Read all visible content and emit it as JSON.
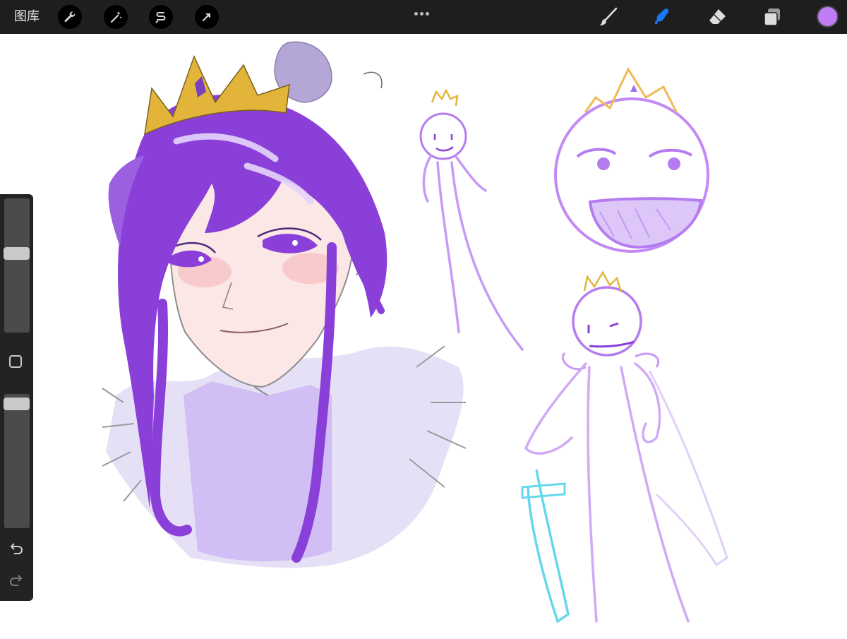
{
  "app": {
    "gallery_label": "图库"
  },
  "toolbar_left": [
    {
      "icon": "wrench-icon",
      "name": "actions"
    },
    {
      "icon": "magic-wand-icon",
      "name": "adjustments"
    },
    {
      "icon": "selection-icon",
      "name": "selection"
    },
    {
      "icon": "transform-arrow-icon",
      "name": "transform"
    }
  ],
  "toolbar_right": [
    {
      "icon": "brush-icon",
      "name": "paint",
      "active": false
    },
    {
      "icon": "smudge-icon",
      "name": "smudge",
      "active": true
    },
    {
      "icon": "eraser-icon",
      "name": "eraser",
      "active": false
    },
    {
      "icon": "layers-icon",
      "name": "layers",
      "active": false
    }
  ],
  "current_color": "#c07cf5",
  "colors": {
    "active_tool": "#1a78ff",
    "hair_purple": "#8a3fd8",
    "crown_gold": "#e2b53a",
    "sketch_purple": "#b57cf0",
    "sword_cyan": "#66d8ec",
    "fur_lavender": "#d6ccf2"
  },
  "sidebar": {
    "brush_size_level": 0.6,
    "opacity_level": 0.97
  }
}
